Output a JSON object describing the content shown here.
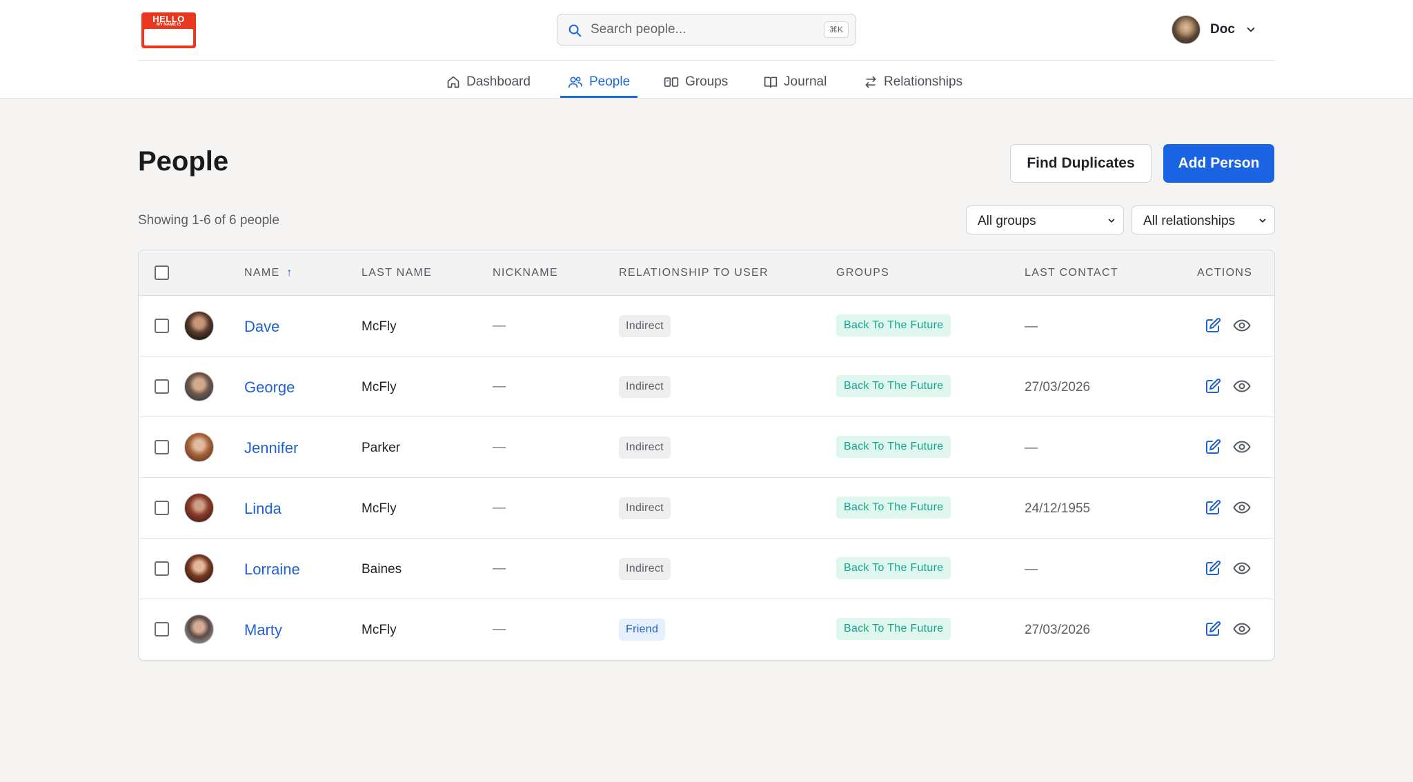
{
  "logo": {
    "line1": "HELLO",
    "line2": "MY NAME IS"
  },
  "search": {
    "placeholder": "Search people...",
    "shortcut": "⌘K"
  },
  "user": {
    "name": "Doc"
  },
  "nav": [
    {
      "label": "Dashboard",
      "icon": "home-icon"
    },
    {
      "label": "People",
      "icon": "users-icon",
      "active": true
    },
    {
      "label": "Groups",
      "icon": "groups-icon"
    },
    {
      "label": "Journal",
      "icon": "book-icon"
    },
    {
      "label": "Relationships",
      "icon": "arrows-swap-icon"
    }
  ],
  "page": {
    "title": "People",
    "find_duplicates_label": "Find Duplicates",
    "add_person_label": "Add Person",
    "showing": "Showing 1-6 of 6 people",
    "groups_filter": "All groups",
    "relationships_filter": "All relationships"
  },
  "table": {
    "columns": {
      "name": "NAME",
      "last_name": "LAST NAME",
      "nickname": "NICKNAME",
      "relationship": "RELATIONSHIP TO USER",
      "groups": "GROUPS",
      "last_contact": "LAST CONTACT",
      "actions": "ACTIONS"
    },
    "sort_indicator": "↑",
    "rows": [
      {
        "first": "Dave",
        "last": "McFly",
        "nickname": "—",
        "relationship": "Indirect",
        "group": "Back To The Future",
        "last_contact": "—"
      },
      {
        "first": "George",
        "last": "McFly",
        "nickname": "—",
        "relationship": "Indirect",
        "group": "Back To The Future",
        "last_contact": "27/03/2026"
      },
      {
        "first": "Jennifer",
        "last": "Parker",
        "nickname": "—",
        "relationship": "Indirect",
        "group": "Back To The Future",
        "last_contact": "—"
      },
      {
        "first": "Linda",
        "last": "McFly",
        "nickname": "—",
        "relationship": "Indirect",
        "group": "Back To The Future",
        "last_contact": "24/12/1955"
      },
      {
        "first": "Lorraine",
        "last": "Baines",
        "nickname": "—",
        "relationship": "Indirect",
        "group": "Back To The Future",
        "last_contact": "—"
      },
      {
        "first": "Marty",
        "last": "McFly",
        "nickname": "—",
        "relationship": "Friend",
        "group": "Back To The Future",
        "last_contact": "27/03/2026"
      }
    ]
  },
  "colors": {
    "accent": "#1a64e4",
    "link": "#1f62cf",
    "group_badge_bg": "#dff6ee",
    "group_badge_text": "#14a68a",
    "logo_red": "#e8371d"
  }
}
